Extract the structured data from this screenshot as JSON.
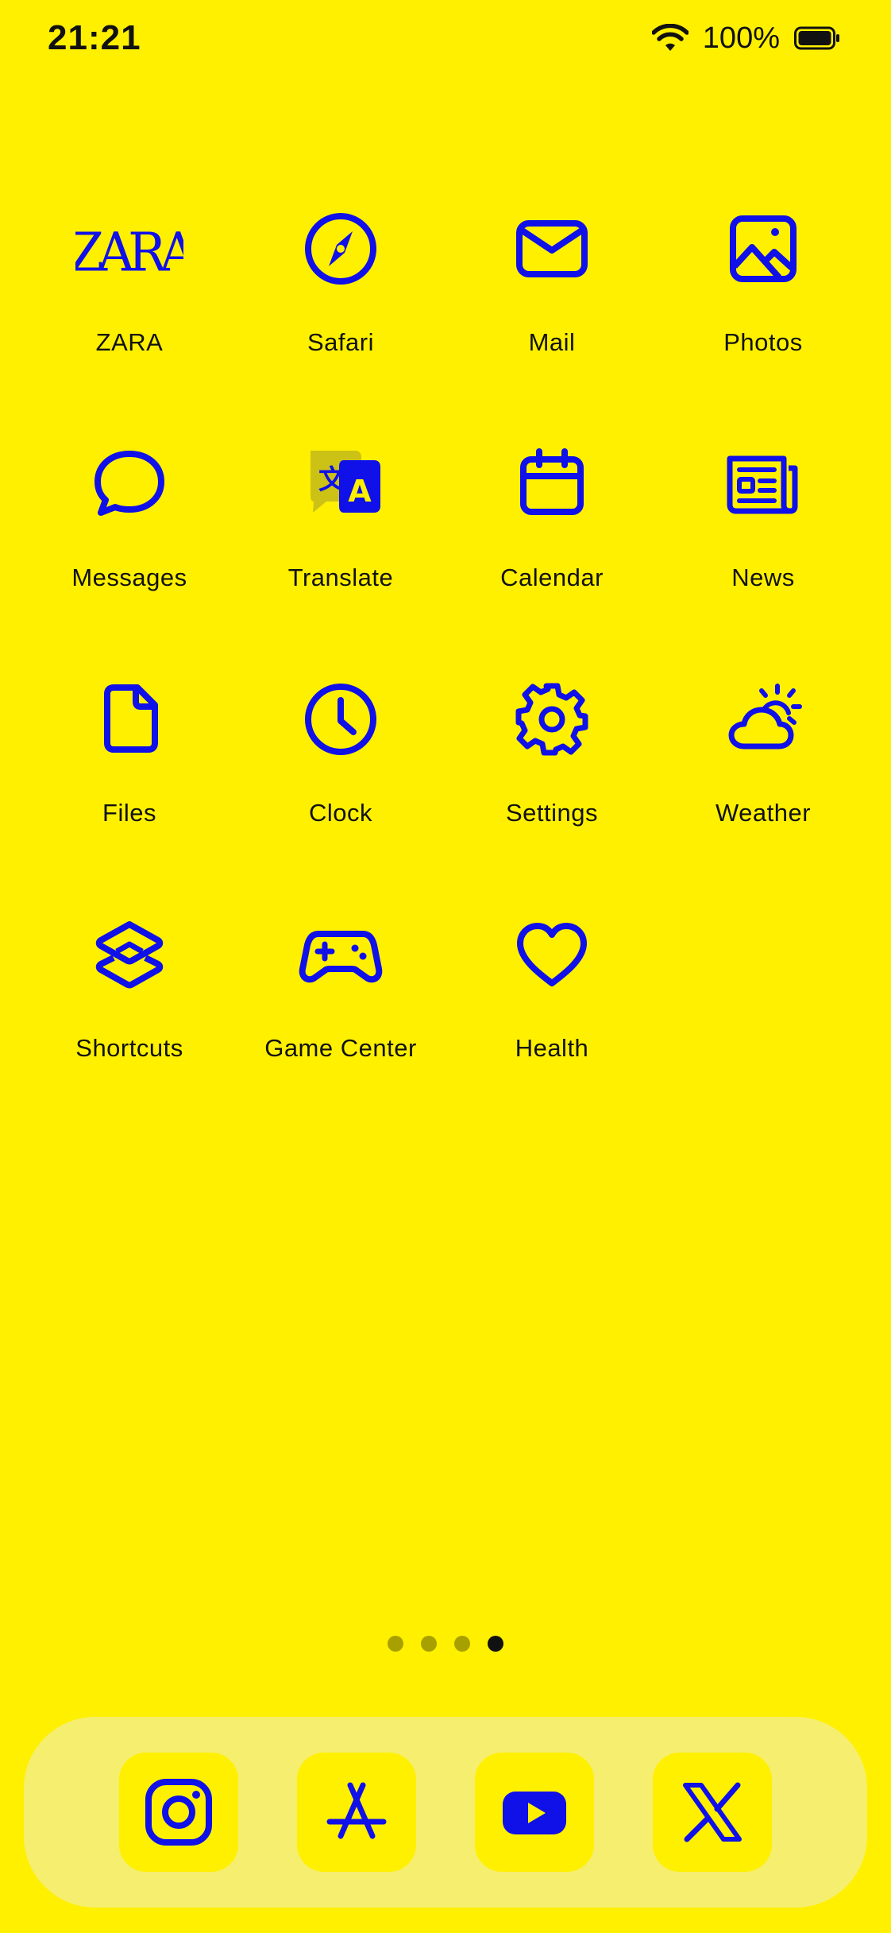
{
  "status_bar": {
    "time": "21:21",
    "battery_percent": "100%",
    "wifi_icon": "wifi-icon",
    "battery_icon": "battery-icon"
  },
  "colors": {
    "background": "#FFF000",
    "icon": "#1010E8",
    "dock": "#F5EE6E",
    "label": "#111111"
  },
  "apps": [
    {
      "label": "ZARA",
      "icon": "zara-icon"
    },
    {
      "label": "Safari",
      "icon": "compass-icon"
    },
    {
      "label": "Mail",
      "icon": "envelope-icon"
    },
    {
      "label": "Photos",
      "icon": "image-icon"
    },
    {
      "label": "Messages",
      "icon": "speech-bubble-icon"
    },
    {
      "label": "Translate",
      "icon": "translate-icon",
      "glyph_left": "文",
      "glyph_right": "A"
    },
    {
      "label": "Calendar",
      "icon": "calendar-icon"
    },
    {
      "label": "News",
      "icon": "newspaper-icon"
    },
    {
      "label": "Files",
      "icon": "file-icon"
    },
    {
      "label": "Clock",
      "icon": "clock-icon"
    },
    {
      "label": "Settings",
      "icon": "gear-icon"
    },
    {
      "label": "Weather",
      "icon": "cloud-sun-icon"
    },
    {
      "label": "Shortcuts",
      "icon": "layers-icon"
    },
    {
      "label": "Game Center",
      "icon": "gamepad-icon"
    },
    {
      "label": "Health",
      "icon": "heart-icon"
    }
  ],
  "page_indicator": {
    "total": 4,
    "current": 4
  },
  "dock": [
    {
      "icon": "instagram-icon"
    },
    {
      "icon": "app-store-icon"
    },
    {
      "icon": "youtube-icon"
    },
    {
      "icon": "x-logo-icon"
    }
  ]
}
